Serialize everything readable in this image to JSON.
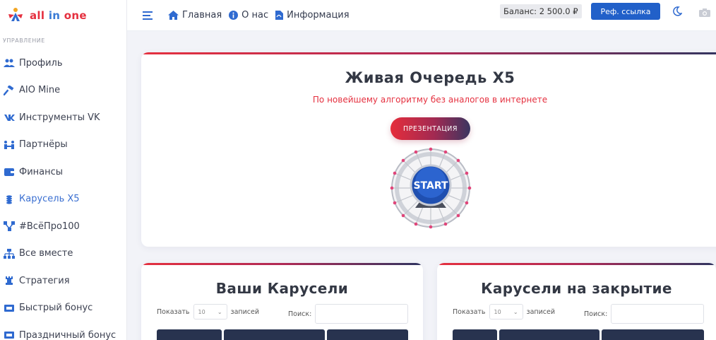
{
  "logo": {
    "word_all": "all",
    "word_in": "in",
    "word_one": "one"
  },
  "sidebar": {
    "section_label": "УПРАВЛЕНИЕ",
    "items": [
      {
        "label": "Профиль",
        "icon": "users-icon",
        "active": false
      },
      {
        "label": "AIO Mine",
        "icon": "hammer-icon",
        "active": false
      },
      {
        "label": "Инструменты VK",
        "icon": "vk-icon",
        "active": false
      },
      {
        "label": "Партнёры",
        "icon": "partners-icon",
        "active": false
      },
      {
        "label": "Финансы",
        "icon": "wallet-icon",
        "active": false
      },
      {
        "label": "Карусель X5",
        "icon": "coins-icon",
        "active": true
      },
      {
        "label": "#ВсёПро100",
        "icon": "network-icon",
        "active": false
      },
      {
        "label": "Все вместе",
        "icon": "sitemap-icon",
        "active": false
      },
      {
        "label": "Стратегия",
        "icon": "chess-rook-icon",
        "active": false
      },
      {
        "label": "Быстрый бонус",
        "icon": "ticket-icon",
        "active": false
      },
      {
        "label": "Праздничный бонус",
        "icon": "ticket-icon",
        "active": false
      }
    ]
  },
  "topbar": {
    "nav": [
      {
        "label": "Главная",
        "icon": "home-icon"
      },
      {
        "label": "О нас",
        "icon": "info-icon"
      },
      {
        "label": "Информация",
        "icon": "file-pdf-icon"
      }
    ],
    "balance": "Баланс: 2 500.0 ₽",
    "ref_button": "Реф. ссылка"
  },
  "hero": {
    "title": "Живая Очередь X5",
    "subtitle": "По новейшему алгоритму без аналогов в интернете",
    "presentation_button": "ПРЕЗЕНТАЦИЯ",
    "start_label": "START"
  },
  "cards": {
    "left": {
      "title": "Ваши Карусели",
      "show_label": "Показать",
      "entries_value": "10",
      "entries_label": "записей",
      "search_label": "Поиск:"
    },
    "right": {
      "title": "Карусели на закрытие",
      "show_label": "Показать",
      "entries_value": "10",
      "entries_label": "записей",
      "search_label": "Поиск:"
    }
  },
  "colors": {
    "accent": "#2160c9",
    "brand_red": "#e5303f",
    "dark_navy": "#28334f"
  }
}
